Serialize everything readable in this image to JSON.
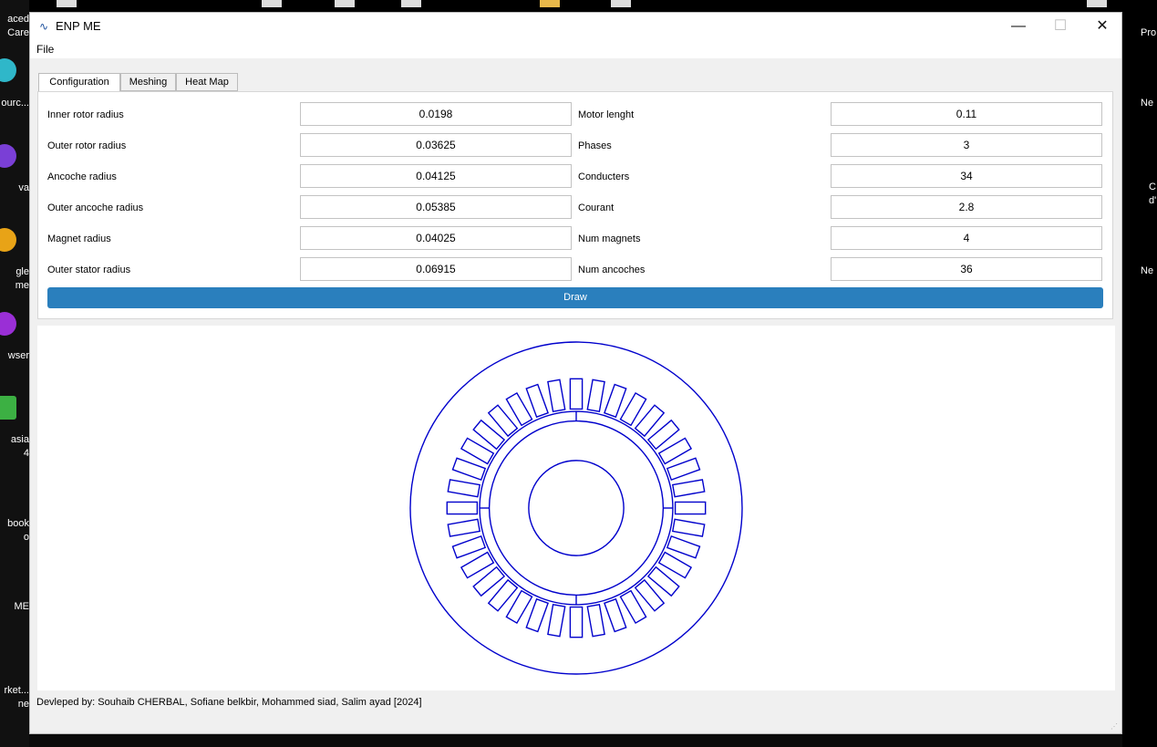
{
  "window": {
    "title": "ENP ME",
    "controls": {
      "minimize": "—",
      "maximize": "☐",
      "close": "✕"
    }
  },
  "menu": {
    "file": "File"
  },
  "tabs": [
    {
      "label": "Configuration",
      "active": true
    },
    {
      "label": "Meshing",
      "active": false
    },
    {
      "label": "Heat Map",
      "active": false
    }
  ],
  "fields_left": [
    {
      "label": "Inner rotor radius",
      "value": "0.0198"
    },
    {
      "label": "Outer rotor radius",
      "value": "0.03625"
    },
    {
      "label": "Ancoche radius",
      "value": "0.04125"
    },
    {
      "label": "Outer ancoche radius",
      "value": "0.05385"
    },
    {
      "label": "Magnet radius",
      "value": "0.04025"
    },
    {
      "label": "Outer stator radius",
      "value": "0.06915"
    }
  ],
  "fields_right": [
    {
      "label": "Motor lenght",
      "value": "0.11"
    },
    {
      "label": "Phases",
      "value": "3"
    },
    {
      "label": "Conducters",
      "value": "34"
    },
    {
      "label": "Courant",
      "value": "2.8"
    },
    {
      "label": "Num magnets",
      "value": "4"
    },
    {
      "label": "Num ancoches",
      "value": "36"
    }
  ],
  "draw_button": "Draw",
  "footer": "Devleped by: Souhaib CHERBAL, Sofiane belkbir, Mohammed siad, Salim ayad [2024]",
  "drawing_color": "#0000cc",
  "accent_color": "#2a7fbd",
  "desktop": {
    "left_labels": [
      "aced",
      "Care",
      "ourc...",
      "va",
      "gle",
      "me",
      "wser",
      "asia",
      "4",
      "book",
      "o",
      "ME",
      "rket...",
      "ne"
    ],
    "right_labels": [
      "Pro",
      "Ne",
      "C",
      "d'",
      "Ne"
    ]
  }
}
